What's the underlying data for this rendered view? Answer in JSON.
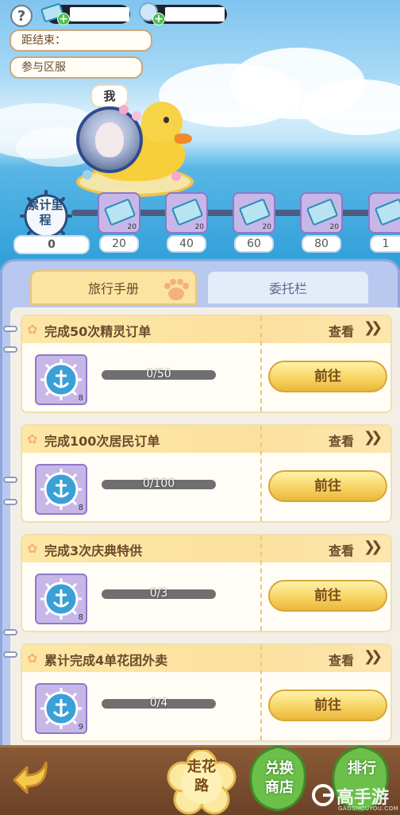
{
  "topbar": {
    "help_label": "?",
    "resource1_value": "",
    "resource2_value": "",
    "plus_label": "+"
  },
  "info": {
    "countdown_label": "距结束：",
    "countdown_value": "",
    "server_label": "参与区服",
    "server_value": ""
  },
  "player": {
    "me_label": "我"
  },
  "mileage": {
    "label": "累计里程",
    "current": "0",
    "milestones": [
      {
        "value": "20",
        "reward_count": "20"
      },
      {
        "value": "40",
        "reward_count": "20"
      },
      {
        "value": "60",
        "reward_count": "20"
      },
      {
        "value": "80",
        "reward_count": "20"
      },
      {
        "value": "1",
        "reward_count": ""
      }
    ]
  },
  "tabs": {
    "active": "旅行手册",
    "inactive": "委托栏"
  },
  "tasks": [
    {
      "title": "完成50次精灵订单",
      "view": "查看",
      "progress_text": "0/50",
      "progress": 0,
      "reward_count": "8",
      "go": "前往"
    },
    {
      "title": "完成100次居民订单",
      "view": "查看",
      "progress_text": "0/100",
      "progress": 0,
      "reward_count": "8",
      "go": "前往"
    },
    {
      "title": "完成3次庆典特供",
      "view": "查看",
      "progress_text": "0/3",
      "progress": 0,
      "reward_count": "8",
      "go": "前往"
    },
    {
      "title": "累计完成4单花团外卖",
      "view": "查看",
      "progress_text": "0/4",
      "progress": 0,
      "reward_count": "9",
      "go": "前往"
    }
  ],
  "bottom": {
    "walk_line1": "走花",
    "walk_line2": "路",
    "shop_line1": "兑换",
    "shop_line2": "商店",
    "rank_line1": "排行",
    "rank_line2": "",
    "watermark": "高手游",
    "watermark_sub": "GAOSHOUYOU.COM"
  }
}
